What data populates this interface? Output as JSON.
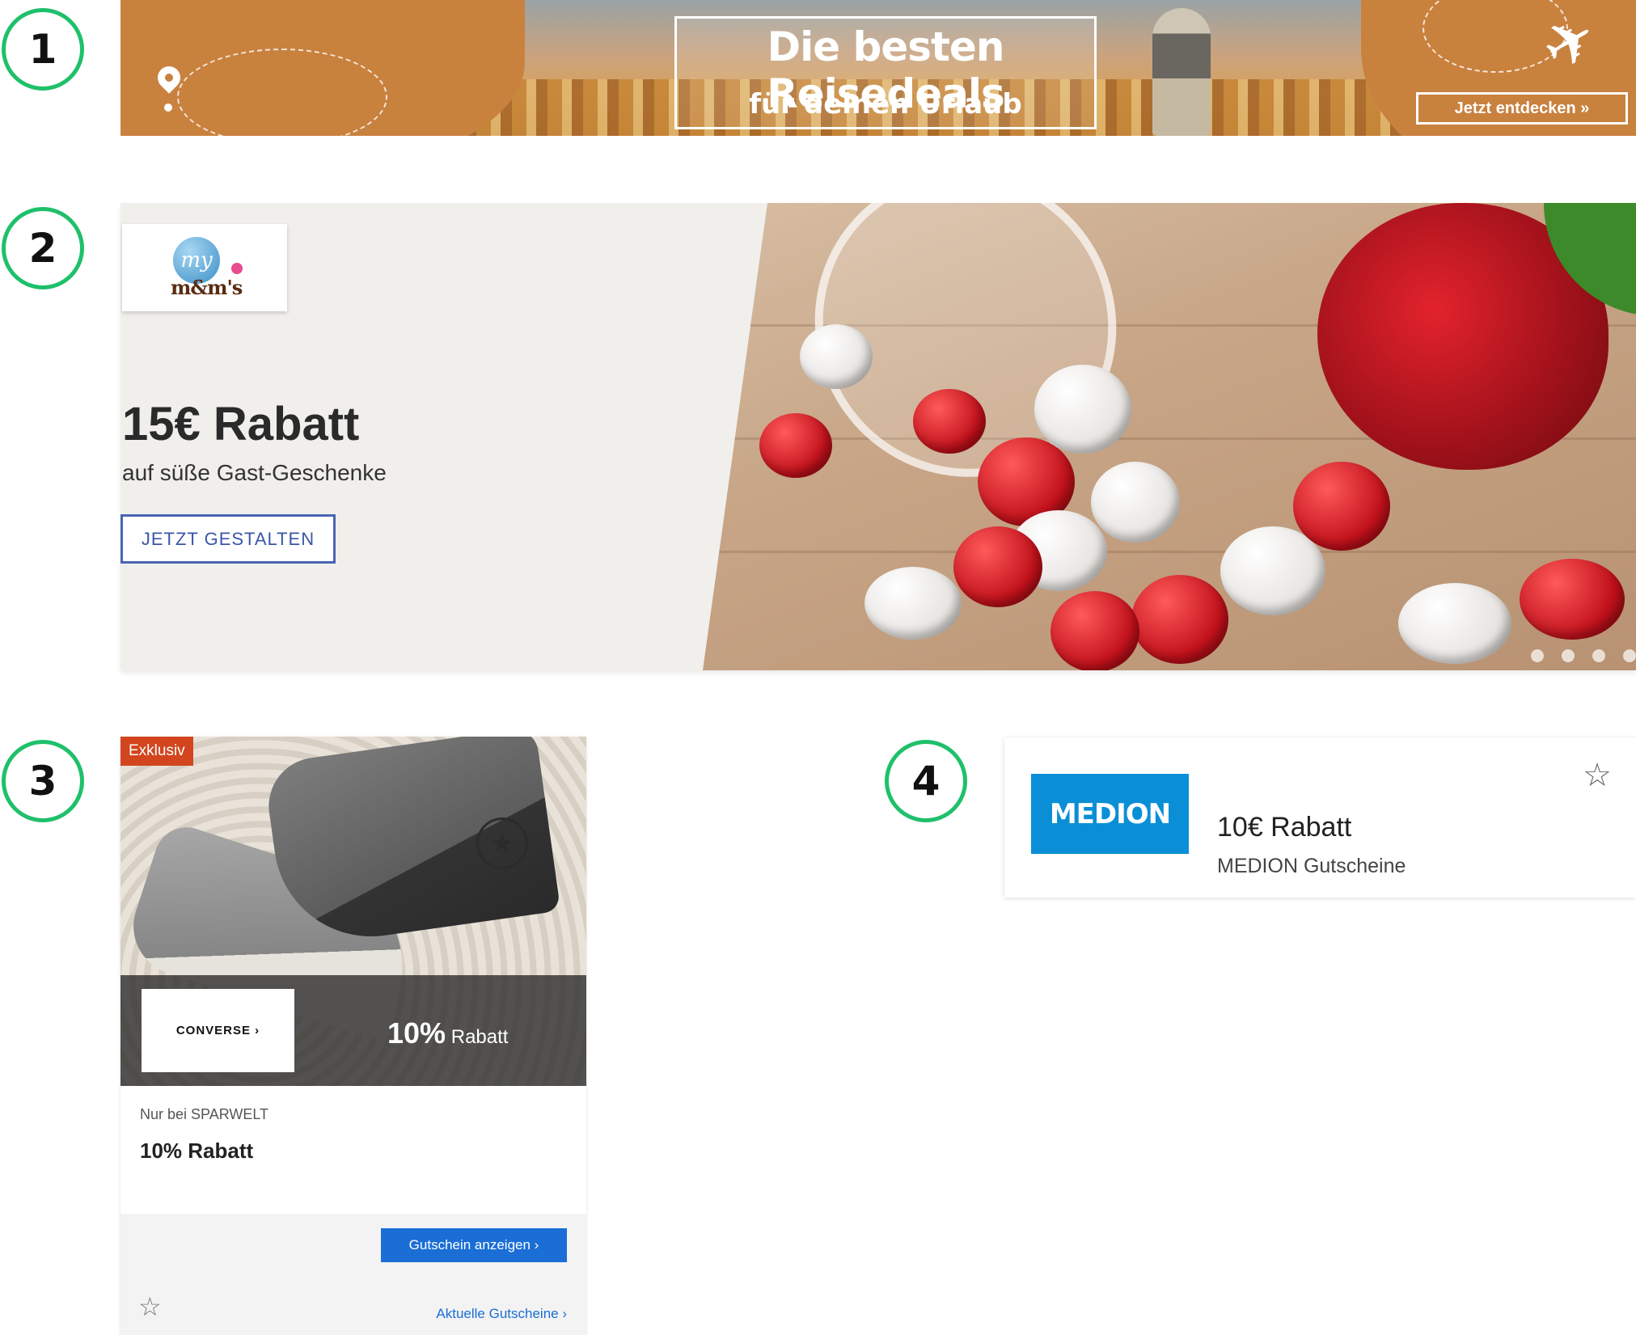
{
  "labels": [
    "1",
    "2",
    "3",
    "4"
  ],
  "banner_travel": {
    "title": "Die besten Reisedeals",
    "subtitle": "für deinen Urlaub",
    "cta": "Jetzt entdecken »",
    "icons": [
      "location-pin-icon",
      "plane-icon"
    ],
    "accent_color": "#c9813e"
  },
  "banner_mms": {
    "logo_my": "my",
    "logo_mm": "m&m's",
    "headline": "15€ Rabatt",
    "subline": "auf süße Gast-Geschenke",
    "button": "JETZT GESTALTEN",
    "button_color": "#3a56a8"
  },
  "card_converse": {
    "badge": "Exklusiv",
    "brand": "CONVERSE ›",
    "discount_value": "10%",
    "discount_label": "Rabatt",
    "only_at": "Nur bei SPARWELT",
    "title": "10% Rabatt",
    "show_button": "Gutschein anzeigen ›",
    "favorite_icon": "☆",
    "all_link": "Aktuelle Gutscheine ›",
    "badge_color": "#d2451e",
    "button_color": "#1a6ed6"
  },
  "card_medion": {
    "logo": "MEDION",
    "title": "10€ Rabatt",
    "subtitle": "MEDION Gutscheine",
    "favorite_icon": "☆",
    "brand_color": "#0a8fd6"
  }
}
